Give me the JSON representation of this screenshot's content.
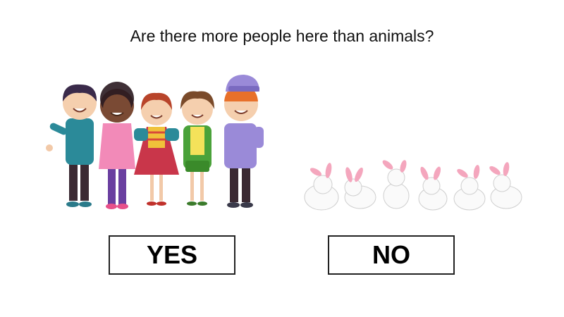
{
  "question": "Are there more people here than animals?",
  "answers": {
    "yes_label": "YES",
    "no_label": "NO"
  },
  "people": [
    "boy-teal-shirt",
    "girl-pink-top",
    "girl-red-dress",
    "girl-green-jacket",
    "boy-purple-cap"
  ],
  "animals": [
    "rabbit",
    "rabbit",
    "rabbit",
    "rabbit",
    "rabbit",
    "rabbit"
  ],
  "colors": {
    "text": "#111111",
    "button_border": "#222222",
    "rabbit_ear": "#f4a6bd"
  }
}
